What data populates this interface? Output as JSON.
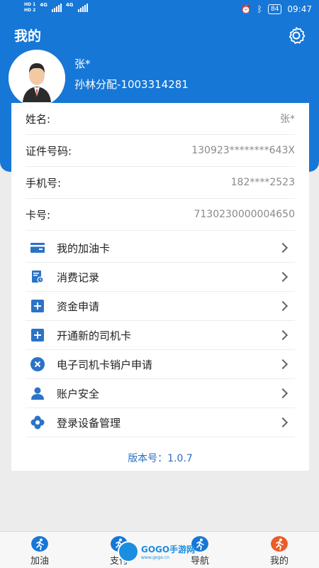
{
  "status_bar": {
    "hd1": "HD 1",
    "hd2": "HD 2",
    "net1": "4G",
    "net2": "4G",
    "battery": "84",
    "time": "09:47"
  },
  "header": {
    "title": "我的",
    "settings_icon": "gear-icon"
  },
  "profile": {
    "name": "张*",
    "subtitle": "孙林分配-1003314281",
    "avatar_icon": "person-avatar"
  },
  "info": [
    {
      "label": "姓名:",
      "value": "张*"
    },
    {
      "label": "证件号码:",
      "value": "130923********643X"
    },
    {
      "label": "手机号:",
      "value": "182****2523"
    },
    {
      "label": "卡号:",
      "value": "7130230000004650"
    }
  ],
  "menu": [
    {
      "label": "我的加油卡",
      "icon": "card-icon"
    },
    {
      "label": "消费记录",
      "icon": "receipt-icon"
    },
    {
      "label": "资金申请",
      "icon": "plus-icon"
    },
    {
      "label": "开通新的司机卡",
      "icon": "plus-icon"
    },
    {
      "label": "电子司机卡销户申请",
      "icon": "close-circle-icon"
    },
    {
      "label": "账户安全",
      "icon": "user-icon"
    },
    {
      "label": "登录设备管理",
      "icon": "flower-icon"
    }
  ],
  "version": "版本号：1.0.7",
  "tabs": [
    {
      "label": "加油",
      "icon": "runner-icon"
    },
    {
      "label": "支付",
      "icon": "runner-icon"
    },
    {
      "label": "导航",
      "icon": "runner-icon"
    },
    {
      "label": "我的",
      "icon": "runner-icon",
      "active": true
    }
  ],
  "watermark": {
    "brand": "GOGO手游网",
    "sub": "www.gogo.cn"
  },
  "colors": {
    "primary": "#1677d6",
    "accent": "#e85d2a",
    "link": "#2a6fc0"
  }
}
